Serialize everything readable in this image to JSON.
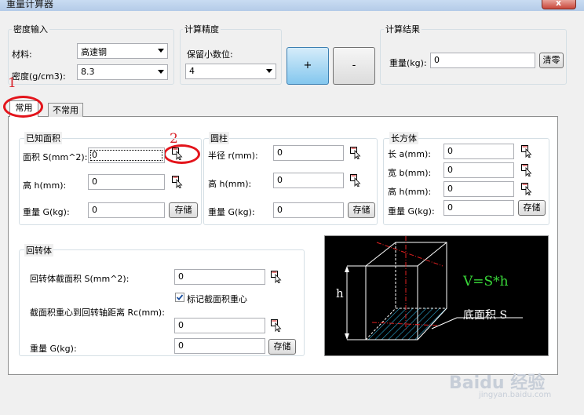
{
  "window": {
    "title": "重量计算器",
    "close_symbol": "x"
  },
  "density_group": {
    "title": "密度输入",
    "material_label": "材料:",
    "material_value": "高速钢",
    "density_label": "密度(g/cm3):",
    "density_value": "8.3"
  },
  "precision_group": {
    "title": "计算精度",
    "decimals_label": "保留小数位:",
    "decimals_value": "4"
  },
  "zoom_buttons": {
    "plus": "+",
    "minus": "-"
  },
  "result_group": {
    "title": "计算结果",
    "weight_label": "重量(kg):",
    "weight_value": "0",
    "clear_label": "清零"
  },
  "tabs": [
    {
      "label": "常用"
    },
    {
      "label": "不常用"
    }
  ],
  "annotations": {
    "mark1": "1",
    "mark2": "2"
  },
  "known_area": {
    "title": "已知面积",
    "area_label": "面积 S(mm^2):",
    "area_value": "0",
    "height_label": "高 h(mm):",
    "height_value": "0",
    "weight_label": "重量 G(kg):",
    "weight_value": "0",
    "store_label": "存储"
  },
  "cylinder": {
    "title": "圆柱",
    "radius_label": "半径 r(mm):",
    "radius_value": "0",
    "height_label": "高 h(mm):",
    "height_value": "0",
    "weight_label": "重量 G(kg):",
    "weight_value": "0",
    "store_label": "存储"
  },
  "cuboid": {
    "title": "长方体",
    "length_label": "长 a(mm):",
    "length_value": "0",
    "width_label": "宽 b(mm):",
    "width_value": "0",
    "height_label": "高 h(mm):",
    "height_value": "0",
    "weight_label": "重量 G(kg):",
    "weight_value": "0",
    "store_label": "存储"
  },
  "revolution": {
    "title": "回转体",
    "section_area_label": "回转体截面积 S(mm^2):",
    "section_area_value": "0",
    "mark_centroid_label": "标记截面积重心",
    "mark_centroid_checked": true,
    "distance_label": "截面积重心到回转轴距离 Rc(mm):",
    "distance_value": "0",
    "weight_label": "重量 G(kg):",
    "weight_value": "0",
    "store_label": "存储"
  },
  "diagram": {
    "formula": "V=S*h",
    "base_label": "底面积 S",
    "height_mark": "h",
    "colors": {
      "background": "#000000",
      "lines": "#ffffff",
      "formula": "#39d839",
      "dash": "#e02020",
      "hatch": "#2aa0c8"
    }
  },
  "watermark": {
    "brand": "Baidu 经验",
    "url": "jingyan.baidu.com"
  }
}
